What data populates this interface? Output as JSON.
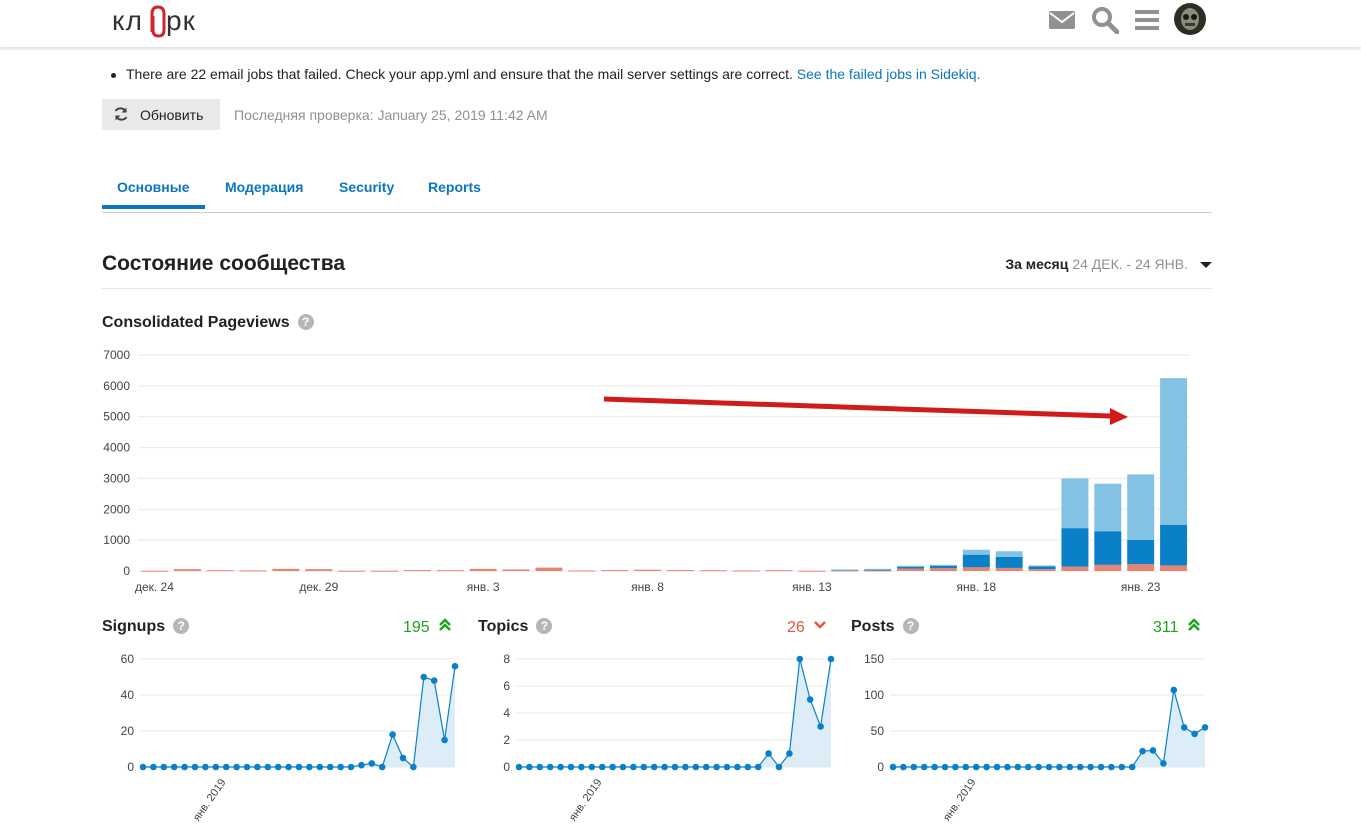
{
  "header": {
    "logo_text": "кл рк",
    "icons": [
      "envelope-icon",
      "search-icon",
      "hamburger-menu-icon",
      "user-avatar"
    ]
  },
  "notice": {
    "text": "There are 22 email jobs that failed. Check your app.yml and ensure that the mail server settings are correct. ",
    "link": "See the failed jobs in Sidekiq."
  },
  "refresh": {
    "label": "Обновить",
    "last_check": "Последняя проверка: January 25, 2019 11:42 AM"
  },
  "tabs": [
    "Основные",
    "Модерация",
    "Security",
    "Reports"
  ],
  "section": {
    "title": "Состояние сообщества",
    "period_label": "За месяц",
    "period_range": "24 ДЕК. - 24 ЯНВ."
  },
  "colors": {
    "accent": "#0a76bf",
    "bar_light": "#83c2e3",
    "bar_dark": "#0a80c8",
    "bar_red": "#e68473",
    "up": "#1ca51c",
    "down": "#e45735",
    "arrow": "#d11a1a"
  },
  "chart_data": [
    {
      "type": "bar",
      "title": "Consolidated Pageviews",
      "stacked": true,
      "ylim": [
        0,
        7000
      ],
      "yticks": [
        0,
        1000,
        2000,
        3000,
        4000,
        5000,
        6000,
        7000
      ],
      "xtick_labels": [
        "дек. 24",
        "дек. 29",
        "янв. 3",
        "янв. 8",
        "янв. 13",
        "янв. 18",
        "янв. 23"
      ],
      "categories": [
        "12-24",
        "12-25",
        "12-26",
        "12-27",
        "12-28",
        "12-29",
        "12-30",
        "12-31",
        "01-01",
        "01-02",
        "01-03",
        "01-04",
        "01-05",
        "01-06",
        "01-07",
        "01-08",
        "01-09",
        "01-10",
        "01-11",
        "01-12",
        "01-13",
        "01-14",
        "01-15",
        "01-16",
        "01-17",
        "01-18",
        "01-19",
        "01-20",
        "01-21",
        "01-22",
        "01-23",
        "01-24"
      ],
      "series": [
        {
          "values": [
            10,
            60,
            25,
            20,
            70,
            60,
            10,
            10,
            30,
            25,
            70,
            50,
            110,
            15,
            30,
            40,
            30,
            25,
            15,
            25,
            10,
            20,
            20,
            80,
            90,
            120,
            100,
            60,
            140,
            200,
            220,
            180
          ]
        },
        {
          "values": [
            0,
            0,
            0,
            0,
            0,
            0,
            0,
            0,
            0,
            0,
            0,
            0,
            0,
            0,
            0,
            0,
            0,
            0,
            0,
            0,
            0,
            20,
            30,
            60,
            80,
            410,
            360,
            90,
            1250,
            1090,
            790,
            1320
          ]
        },
        {
          "values": [
            0,
            0,
            0,
            0,
            0,
            0,
            0,
            0,
            0,
            0,
            0,
            0,
            0,
            0,
            0,
            0,
            0,
            0,
            0,
            0,
            0,
            10,
            20,
            30,
            30,
            160,
            180,
            30,
            1610,
            1540,
            2120,
            4750
          ]
        }
      ]
    },
    {
      "type": "line",
      "title": "Signups",
      "stat": "195",
      "trend": "up",
      "ylim": [
        0,
        60
      ],
      "yticks": [
        0,
        20,
        40,
        60
      ],
      "xlabel_tick": "янв. 2019",
      "values": [
        0,
        0,
        0,
        0,
        0,
        0,
        0,
        0,
        0,
        0,
        0,
        0,
        0,
        0,
        0,
        0,
        0,
        0,
        0,
        0,
        0,
        1,
        2,
        0,
        18,
        5,
        0,
        50,
        48,
        15,
        56
      ]
    },
    {
      "type": "line",
      "title": "Topics",
      "stat": "26",
      "trend": "down",
      "ylim": [
        0,
        8
      ],
      "yticks": [
        0,
        2,
        4,
        6,
        8
      ],
      "xlabel_tick": "янв. 2019",
      "values": [
        0,
        0,
        0,
        0,
        0,
        0,
        0,
        0,
        0,
        0,
        0,
        0,
        0,
        0,
        0,
        0,
        0,
        0,
        0,
        0,
        0,
        0,
        0,
        0,
        1,
        0,
        1,
        8,
        5,
        3,
        8
      ]
    },
    {
      "type": "line",
      "title": "Posts",
      "stat": "311",
      "trend": "up",
      "ylim": [
        0,
        150
      ],
      "yticks": [
        0,
        50,
        100,
        150
      ],
      "xlabel_tick": "янв. 2019",
      "values": [
        0,
        0,
        0,
        0,
        0,
        0,
        0,
        0,
        0,
        0,
        0,
        0,
        0,
        0,
        0,
        0,
        0,
        0,
        0,
        0,
        0,
        0,
        0,
        0,
        22,
        23,
        5,
        107,
        55,
        46,
        55
      ]
    }
  ]
}
